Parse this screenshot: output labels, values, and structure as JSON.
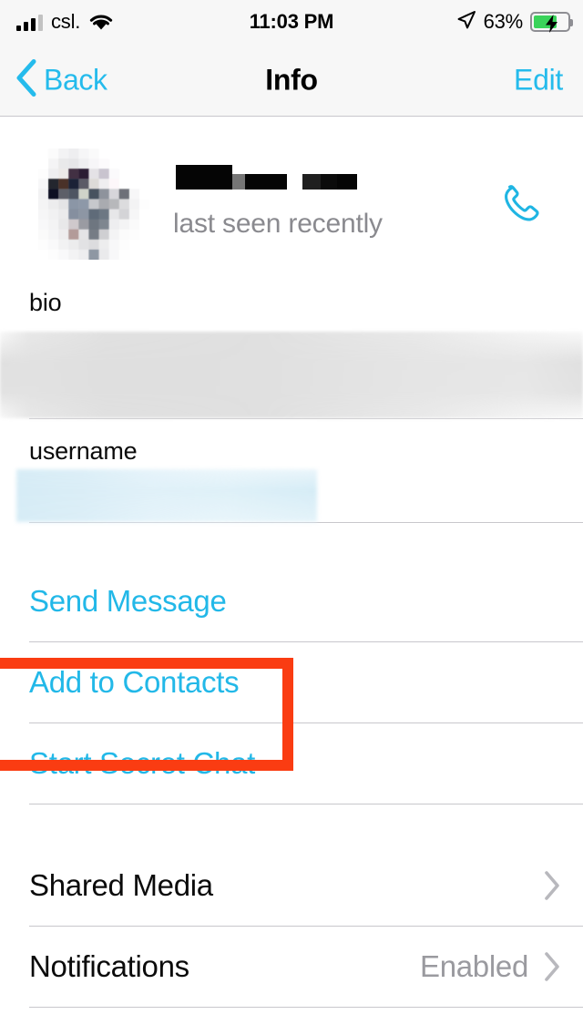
{
  "status_bar": {
    "carrier": "csl.",
    "time": "11:03 PM",
    "battery_percent": "63%",
    "battery_level": 63,
    "charging": true,
    "wifi": true,
    "location_services": true,
    "signal_bars_filled": 3,
    "signal_bars_total": 4
  },
  "nav": {
    "back_label": "Back",
    "title": "Info",
    "edit_label": "Edit"
  },
  "profile": {
    "name": "",
    "name_redacted": true,
    "status": "last seen recently",
    "avatar_pixelated": true,
    "call_action": "call"
  },
  "fields": [
    {
      "label": "bio",
      "value": "",
      "redacted": true,
      "redaction_style": "blur-gray"
    },
    {
      "label": "username",
      "value": "",
      "redacted": true,
      "redaction_style": "blur-blue"
    }
  ],
  "actions": [
    {
      "label": "Send Message",
      "highlighted": false
    },
    {
      "label": "Add to Contacts",
      "highlighted": true
    },
    {
      "label": "Start Secret Chat",
      "highlighted": false
    }
  ],
  "settings": [
    {
      "label": "Shared Media",
      "value": "",
      "chevron": true
    },
    {
      "label": "Notifications",
      "value": "Enabled",
      "chevron": true
    }
  ],
  "colors": {
    "accent": "#22b8e8",
    "highlight": "#fa3c12",
    "separator": "#c8c7cc",
    "secondary_text": "#8a8a8f",
    "bar_background": "#f7f7f7",
    "battery_green": "#3ad35a"
  }
}
